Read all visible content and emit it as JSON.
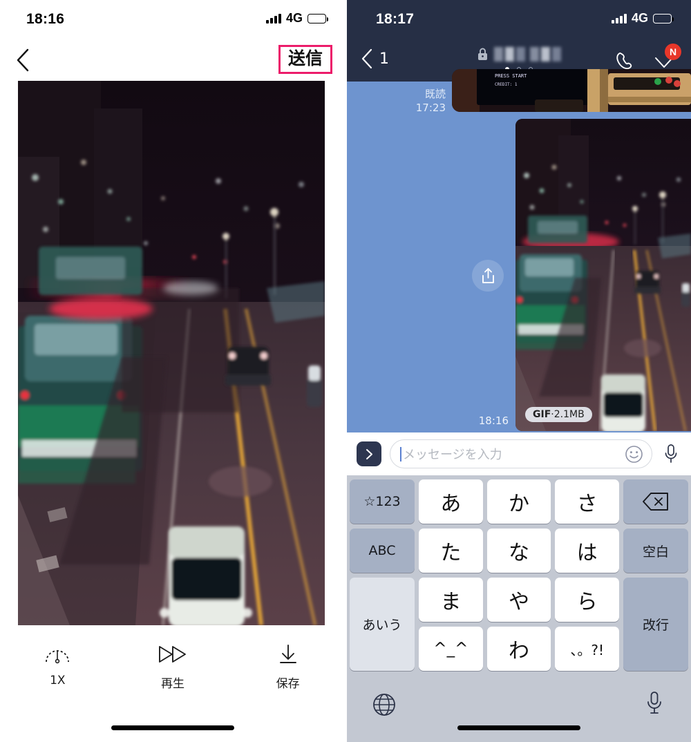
{
  "left_panel": {
    "status_bar": {
      "time": "18:16",
      "network": "4G",
      "signal_icon": "signal-bars-icon",
      "battery_icon": "battery-icon"
    },
    "nav_bar": {
      "back_icon": "chevron-left-icon",
      "send_label": "送信",
      "send_highlight_color": "#ec1c6a"
    },
    "media": {
      "type": "photo-preview",
      "description": "night-highway-photo"
    },
    "toolbar": [
      {
        "icon": "speedometer-icon",
        "label": "1X"
      },
      {
        "icon": "fast-forward-icon",
        "label": "再生"
      },
      {
        "icon": "download-icon",
        "label": "保存"
      }
    ]
  },
  "right_panel": {
    "status_bar": {
      "time": "18:17",
      "network": "4G",
      "signal_icon": "signal-bars-icon",
      "battery_icon": "battery-icon"
    },
    "nav_bar": {
      "back_icon": "chevron-left-icon",
      "back_count": "1",
      "lock_icon": "lock-icon",
      "contact_name": "",
      "page_dots": 3,
      "active_dot": 1,
      "call_icon": "phone-icon",
      "chevron_icon": "chevron-down-icon",
      "badge_label": "N",
      "badge_color": "#e8372a",
      "header_color": "#262f45"
    },
    "chat": {
      "background_color": "#6e94cf",
      "messages": [
        {
          "type": "image",
          "read_status": "既読",
          "time": "17:23",
          "content": "arcade-cabinet-photo"
        },
        {
          "type": "image",
          "time": "18:16",
          "content": "night-highway-photo",
          "badge_type": "GIF",
          "badge_size": "2.1MB",
          "badge_separator": "·",
          "share_icon": "share-upload-icon"
        }
      ]
    },
    "input_bar": {
      "expand_icon": "chevron-right-icon",
      "placeholder": "メッセージを入力",
      "value": "",
      "emoji_icon": "smiley-icon",
      "mic_icon": "microphone-icon"
    },
    "keyboard": {
      "type": "japanese-kana-12key",
      "background_color": "#c3c8d2",
      "rows": [
        {
          "left": "☆123",
          "keys": [
            "あ",
            "か",
            "さ"
          ],
          "right": "delete-icon"
        },
        {
          "left": "ABC",
          "keys": [
            "た",
            "な",
            "は"
          ],
          "right": "空白"
        },
        {
          "left": "あいう",
          "keys": [
            "ま",
            "や",
            "ら"
          ],
          "right": "改行"
        },
        {
          "keys": [
            "^_^",
            "わ",
            "、。?!"
          ]
        }
      ],
      "bottom": {
        "globe_icon": "globe-icon",
        "mic_icon": "microphone-icon"
      }
    }
  }
}
